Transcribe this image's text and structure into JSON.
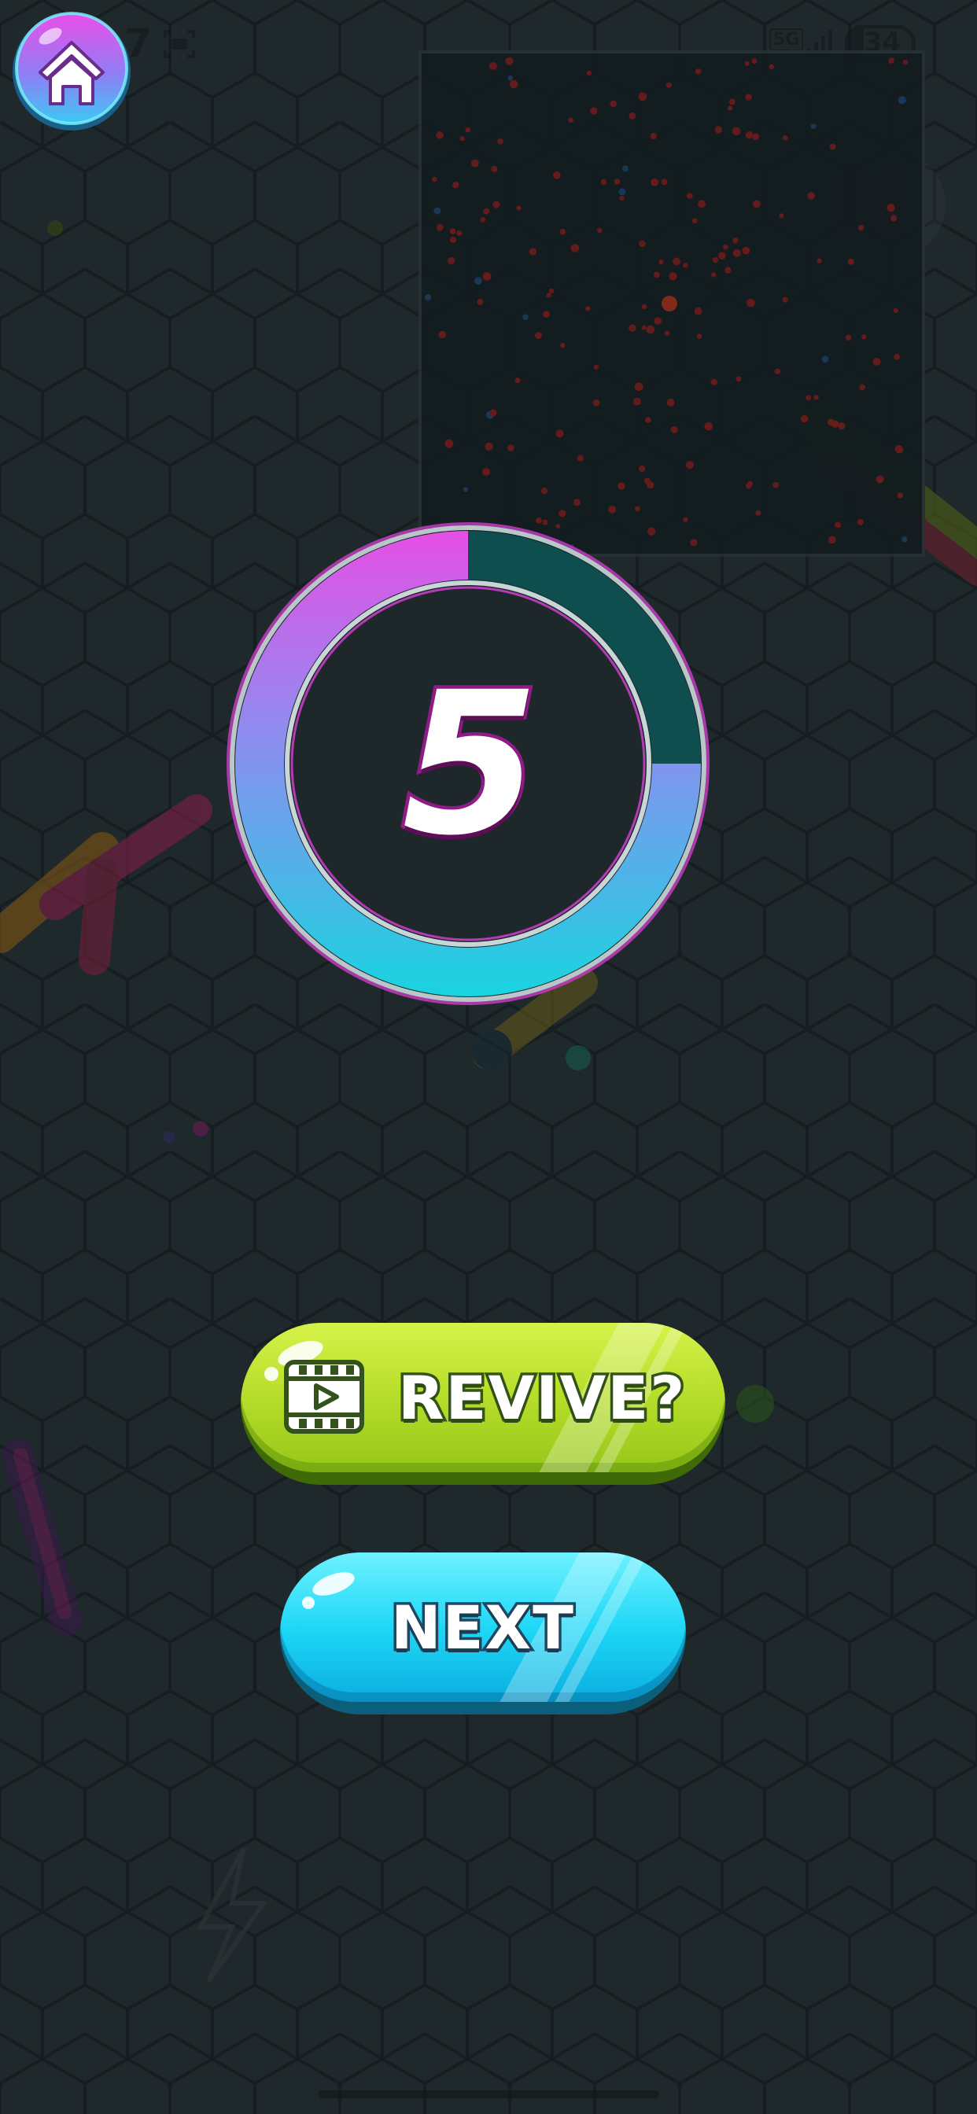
{
  "status_bar": {
    "time": "7",
    "network": "5G",
    "battery": "34"
  },
  "home_button": {
    "icon": "home-icon"
  },
  "countdown": {
    "value": "5",
    "progress_remaining": 0.75
  },
  "revive_button": {
    "label": "REVIVE?",
    "icon": "video-ad-icon"
  },
  "next_button": {
    "label": "NEXT"
  },
  "colors": {
    "background": "#1d2629",
    "revive_green": "#b9df2c",
    "next_cyan": "#1fd8f7",
    "ring_magenta": "#e54fe4",
    "ring_cyan": "#19d4e0",
    "ring_track": "#0e4e4e"
  }
}
